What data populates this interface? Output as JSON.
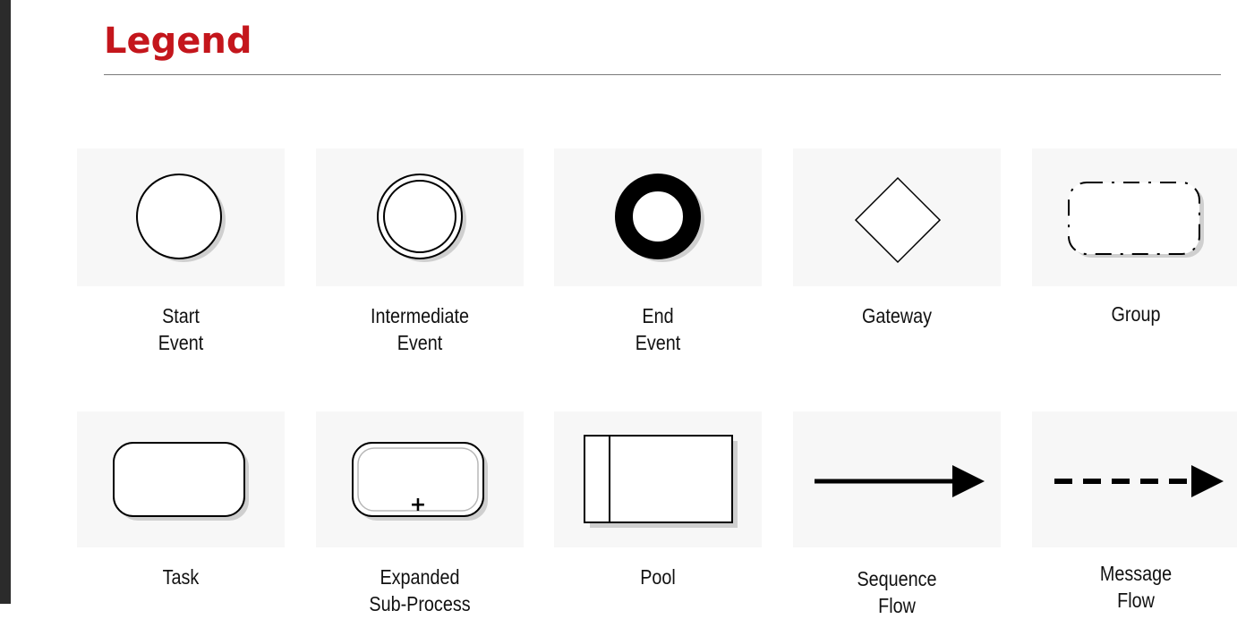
{
  "legend": {
    "title": "Legend",
    "items": [
      {
        "label_line1": "Start",
        "label_line2": "Event",
        "icon": "start-event-icon"
      },
      {
        "label_line1": "Intermediate",
        "label_line2": "Event",
        "icon": "intermediate-event-icon"
      },
      {
        "label_line1": "End",
        "label_line2": "Event",
        "icon": "end-event-icon"
      },
      {
        "label_line1": "Gateway",
        "label_line2": "",
        "icon": "gateway-icon"
      },
      {
        "label_line1": "Group",
        "label_line2": "",
        "icon": "group-icon"
      },
      {
        "label_line1": "Task",
        "label_line2": "",
        "icon": "task-icon"
      },
      {
        "label_line1": "Expanded",
        "label_line2": "Sub-Process",
        "icon": "expanded-sub-process-icon"
      },
      {
        "label_line1": "Pool",
        "label_line2": "",
        "icon": "pool-icon"
      },
      {
        "label_line1": "Sequence",
        "label_line2": "Flow",
        "icon": "sequence-flow-icon"
      },
      {
        "label_line1": "Message",
        "label_line2": "Flow",
        "icon": "message-flow-icon"
      }
    ],
    "plus_symbol": "+"
  },
  "colors": {
    "title": "#c4161c",
    "card_background": "#f7f7f7",
    "shadow": "#cfcfcf",
    "stroke": "#000000"
  }
}
